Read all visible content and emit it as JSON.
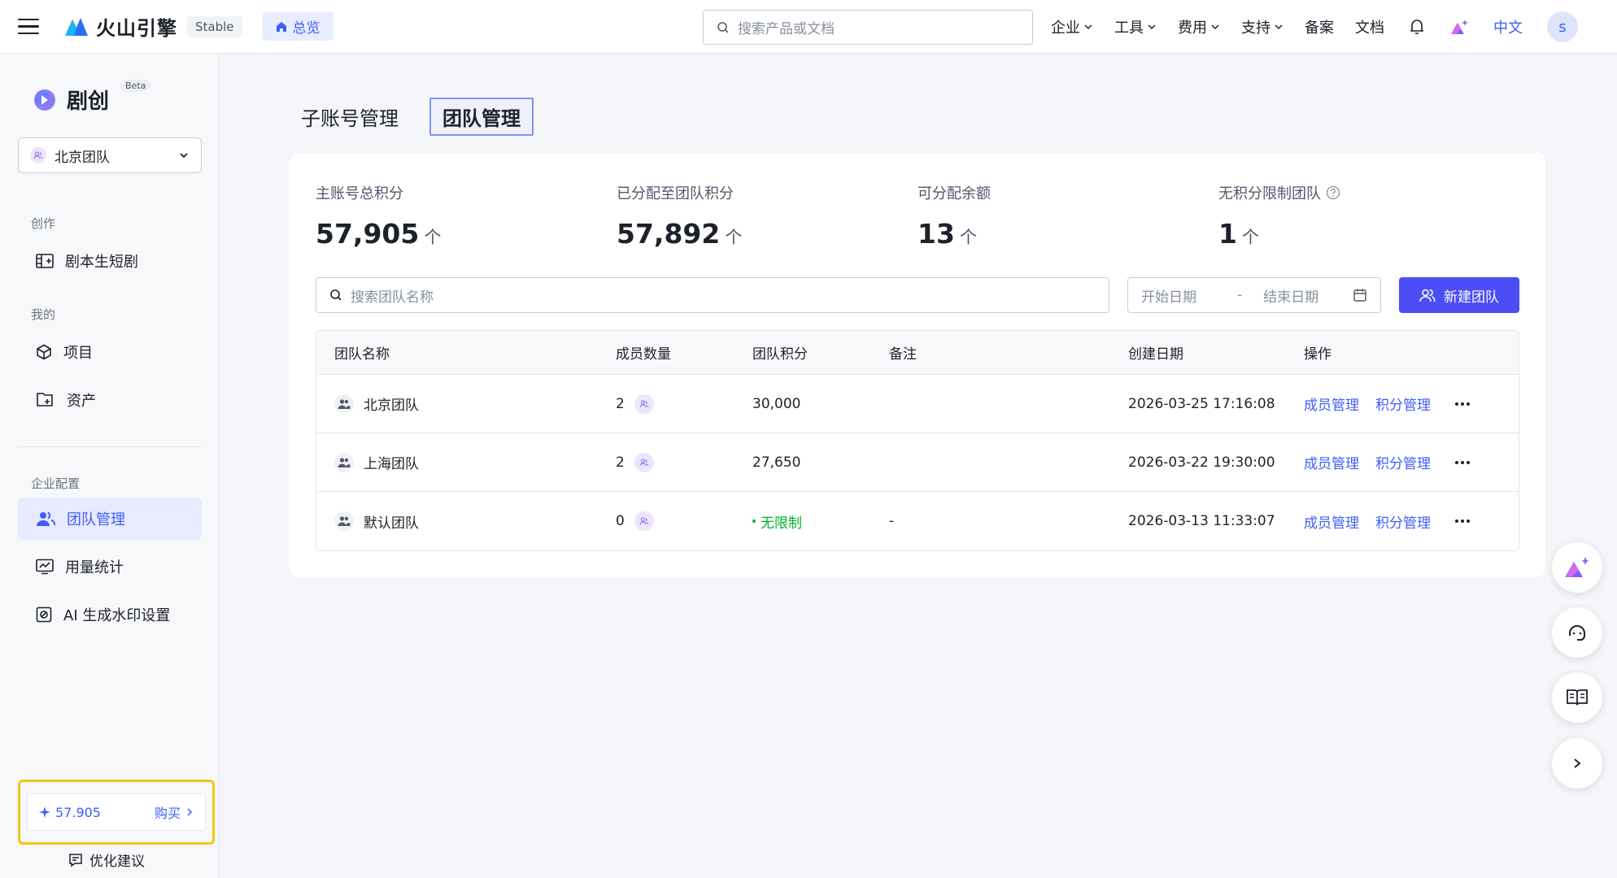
{
  "topbar": {
    "brand": "火山引擎",
    "badge": "Stable",
    "overview": "总览",
    "search_placeholder": "搜索产品或文档",
    "nav": [
      {
        "label": "企业",
        "dropdown": true
      },
      {
        "label": "工具",
        "dropdown": true
      },
      {
        "label": "费用",
        "dropdown": true
      },
      {
        "label": "支持",
        "dropdown": true
      },
      {
        "label": "备案",
        "dropdown": false
      },
      {
        "label": "文档",
        "dropdown": false
      }
    ],
    "lang": "中文",
    "avatar": "s"
  },
  "sidebar": {
    "app_name": "剧创",
    "beta": "Beta",
    "team_select": "北京团队",
    "sections": {
      "create": "创作",
      "mine": "我的",
      "enterprise": "企业配置"
    },
    "items": {
      "script_drama": "剧本生短剧",
      "project": "项目",
      "assets": "资产",
      "team_mgmt": "团队管理",
      "usage": "用量统计",
      "watermark": "AI 生成水印设置"
    },
    "credits": "57.905",
    "buy": "购买",
    "feedback": "优化建议"
  },
  "main": {
    "tabs": [
      "子账号管理",
      "团队管理"
    ],
    "active_tab": 1,
    "stats": [
      {
        "label": "主账号总积分",
        "value": "57,905",
        "unit": "个"
      },
      {
        "label": "已分配至团队积分",
        "value": "57,892",
        "unit": "个"
      },
      {
        "label": "可分配余额",
        "value": "13",
        "unit": "个"
      },
      {
        "label": "无积分限制团队",
        "value": "1",
        "unit": "个",
        "help": true
      }
    ],
    "search_placeholder": "搜索团队名称",
    "date_start": "开始日期",
    "date_sep": "-",
    "date_end": "结束日期",
    "new_team": "新建团队",
    "table": {
      "headers": [
        "团队名称",
        "成员数量",
        "团队积分",
        "备注",
        "创建日期",
        "操作"
      ],
      "rows": [
        {
          "name": "北京团队",
          "members": "2",
          "credits": "30,000",
          "note": "",
          "created": "2026-03-25 17:16:08",
          "action1": "成员管理",
          "action2": "积分管理"
        },
        {
          "name": "上海团队",
          "members": "2",
          "credits": "27,650",
          "note": "",
          "created": "2026-03-22 19:30:00",
          "action1": "成员管理",
          "action2": "积分管理"
        },
        {
          "name": "默认团队",
          "members": "0",
          "credits": "无限制",
          "note": "-",
          "created": "2026-03-13 11:33:07",
          "action1": "成员管理",
          "action2": "积分管理"
        }
      ]
    }
  },
  "colors": {
    "accent": "#3f5efb",
    "primary_button": "#4b4df5",
    "success": "#00b42a",
    "highlight_border": "#f5c518"
  }
}
